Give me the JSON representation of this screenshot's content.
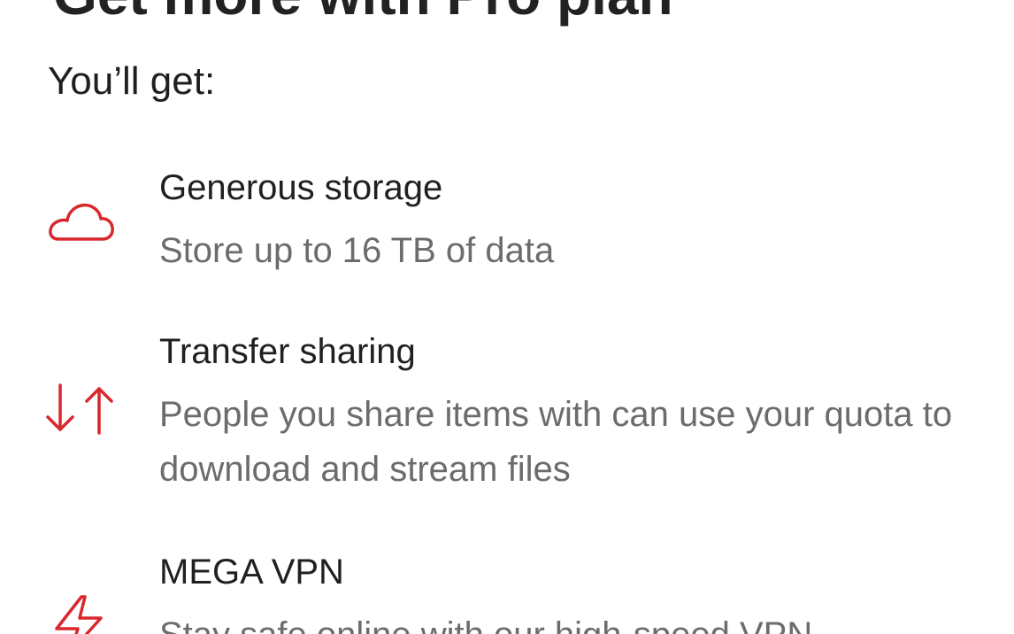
{
  "header": {
    "title": "Get more with Pro plan",
    "subtitle": "You’ll get:"
  },
  "accent_color": "#d9272e",
  "features": [
    {
      "icon": "cloud-icon",
      "title": "Generous storage",
      "description": "Store up to 16 TB of data"
    },
    {
      "icon": "transfer-arrows-icon",
      "title": "Transfer sharing",
      "description": "People you share items with can use your quota to download and stream files"
    },
    {
      "icon": "lightning-icon",
      "title": "MEGA VPN",
      "description": "Stay safe online with our high-speed VPN"
    }
  ]
}
